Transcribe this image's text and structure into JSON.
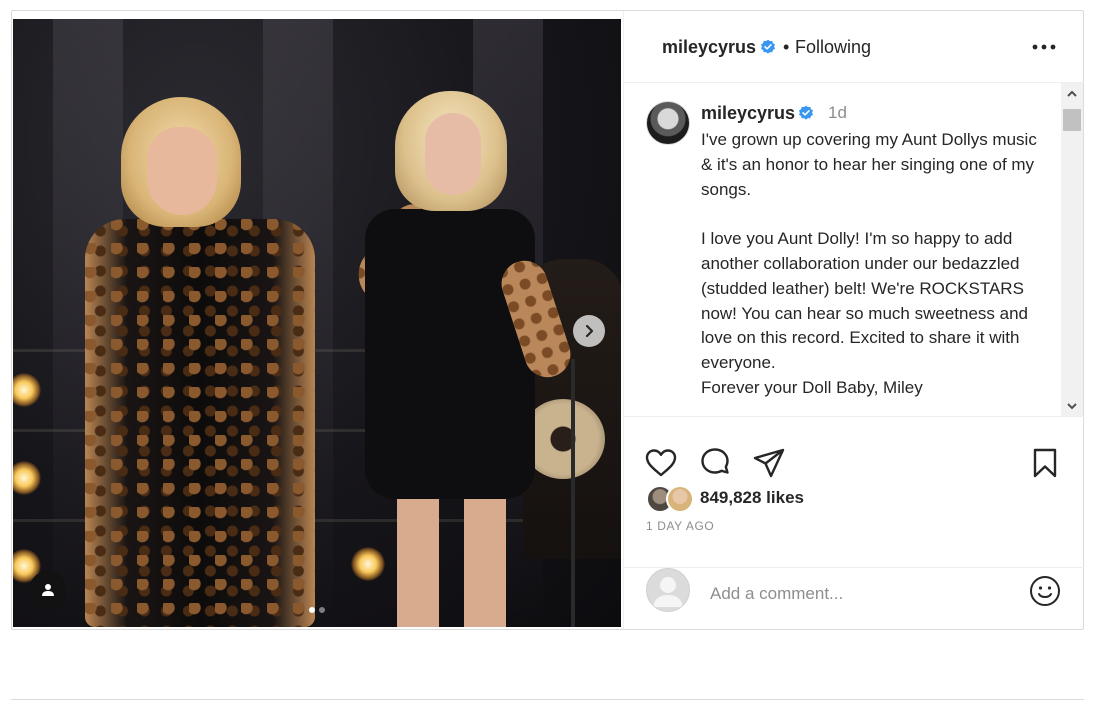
{
  "post": {
    "header": {
      "username": "mileycyrus",
      "separator": "•",
      "follow_status": "Following",
      "verified_icon": "verified-badge-icon",
      "more_icon": "more-options-icon"
    },
    "media": {
      "carousel_total": 2,
      "carousel_current": 1,
      "next_icon": "chevron-right-icon",
      "tag_icon": "user-tag-icon"
    },
    "caption": {
      "username": "mileycyrus",
      "time": "1d",
      "paragraphs": [
        "I've grown up covering my Aunt Dollys music & it's an honor to hear her singing one of my songs.",
        "I love you Aunt Dolly! I'm so happy to add another collaboration under our bedazzled (studded leather) belt! We're ROCKSTARS now! You can hear so much sweetness and love on this record. Excited to share it with everyone.\nForever your Doll Baby, Miley"
      ]
    },
    "actions": {
      "like_icon": "heart-icon",
      "comment_icon": "comment-icon",
      "share_icon": "share-icon",
      "save_icon": "bookmark-icon"
    },
    "likes": "849,828 likes",
    "posted_ago": "1 DAY AGO",
    "comment": {
      "placeholder": "Add a comment...",
      "emoji_icon": "emoji-smile-icon"
    }
  },
  "colors": {
    "verified": "#3897f0",
    "text": "#262626",
    "muted": "#8e8e8e",
    "border": "#dbdbdb"
  }
}
